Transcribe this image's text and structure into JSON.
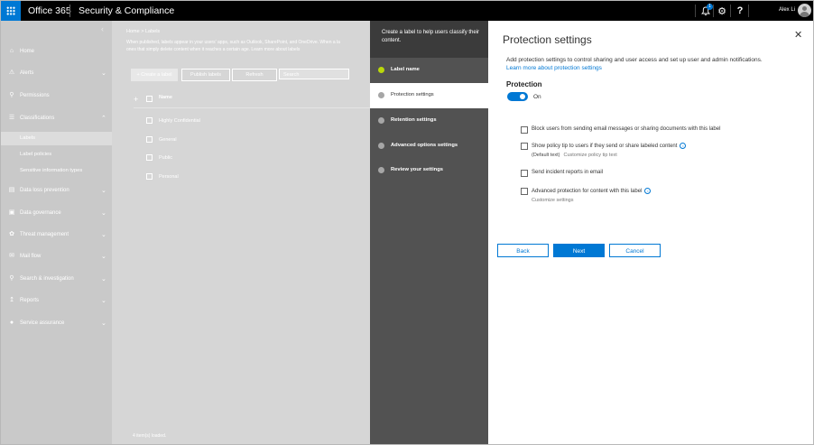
{
  "topbar": {
    "brand": "Office 365",
    "product": "Security & Compliance",
    "notification_count": "1",
    "user_name": "Alex Li"
  },
  "nav": {
    "items": [
      {
        "label": "Home"
      },
      {
        "label": "Alerts"
      },
      {
        "label": "Permissions"
      },
      {
        "label": "Classifications"
      },
      {
        "label": "Data loss prevention"
      },
      {
        "label": "Data governance"
      },
      {
        "label": "Threat management"
      },
      {
        "label": "Mail flow"
      },
      {
        "label": "Search & investigation"
      },
      {
        "label": "Reports"
      },
      {
        "label": "Service assurance"
      }
    ],
    "sub_items": [
      {
        "label": "Labels"
      },
      {
        "label": "Label policies"
      },
      {
        "label": "Sensitive information types"
      }
    ]
  },
  "main": {
    "breadcrumb": [
      "Home",
      "Labels"
    ],
    "description_line1": "When published, labels appear in your users' apps, such as Outlook, SharePoint, and OneDrive. When a la",
    "description_line2": "ones that simply delete content when it reaches a certain age.",
    "learn_more": "Learn more about labels",
    "create_label": "+ Create a label",
    "publish_labels": "Publish labels",
    "refresh": "Refresh",
    "search_placeholder": "Search",
    "column_name": "Name",
    "rows": [
      "Highly Confidential",
      "General",
      "Public",
      "Personal"
    ],
    "items_loaded": "4 item(s) loaded."
  },
  "wizard": {
    "header": "Create a label to help users classify their content.",
    "steps": [
      {
        "label": "Label name",
        "state": "done"
      },
      {
        "label": "Protection settings",
        "state": "current"
      },
      {
        "label": "Retention settings",
        "state": "pending"
      },
      {
        "label": "Advanced options settings",
        "state": "pending"
      },
      {
        "label": "Review your settings",
        "state": "pending"
      }
    ]
  },
  "panel": {
    "title": "Protection settings",
    "description": "Add protection settings to control sharing and user access and set up user and admin notifications.",
    "learn_more": "Learn more about protection settings",
    "section_title": "Protection",
    "toggle_on": true,
    "toggle_label": "On",
    "options": [
      {
        "label": "Block users from sending email messages or sharing documents with this label",
        "checked": false
      },
      {
        "label": "Show policy tip to users if they send or share labeled content",
        "checked": false,
        "sub": "(Default text)",
        "sub_link": "Customize policy tip text"
      },
      {
        "label": "Send incident reports in email",
        "checked": false
      },
      {
        "label": "Advanced protection for content with this label",
        "checked": false,
        "sub_link": "Customize settings"
      }
    ],
    "back_label": "Back",
    "next_label": "Next",
    "cancel_label": "Cancel"
  },
  "colors": {
    "accent": "#0078d4",
    "done_step": "#bad80a",
    "topbar": "#000000",
    "wizard_bg": "#525252"
  }
}
